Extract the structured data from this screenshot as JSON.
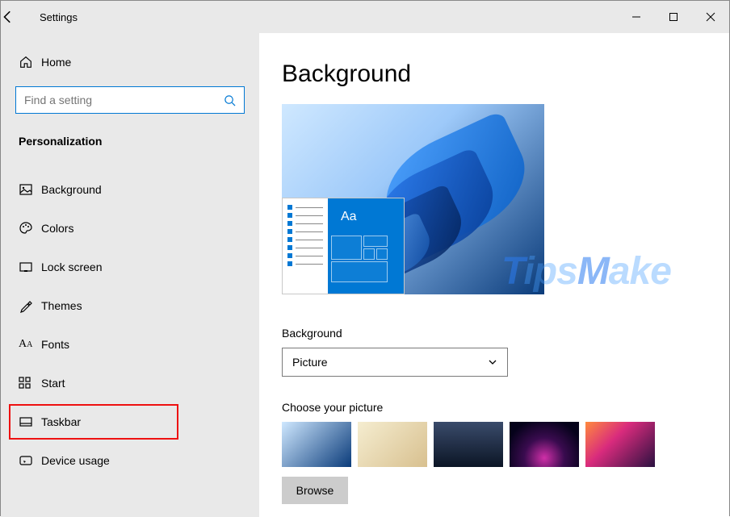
{
  "window": {
    "title": "Settings"
  },
  "sidebar": {
    "home_label": "Home",
    "search_placeholder": "Find a setting",
    "section_title": "Personalization",
    "items": [
      {
        "label": "Background"
      },
      {
        "label": "Colors"
      },
      {
        "label": "Lock screen"
      },
      {
        "label": "Themes"
      },
      {
        "label": "Fonts"
      },
      {
        "label": "Start"
      },
      {
        "label": "Taskbar"
      },
      {
        "label": "Device usage"
      }
    ]
  },
  "main": {
    "heading": "Background",
    "background_label": "Background",
    "background_value": "Picture",
    "choose_label": "Choose your picture",
    "browse_label": "Browse",
    "preview_aa": "Aa"
  },
  "watermark": "TipsMake"
}
